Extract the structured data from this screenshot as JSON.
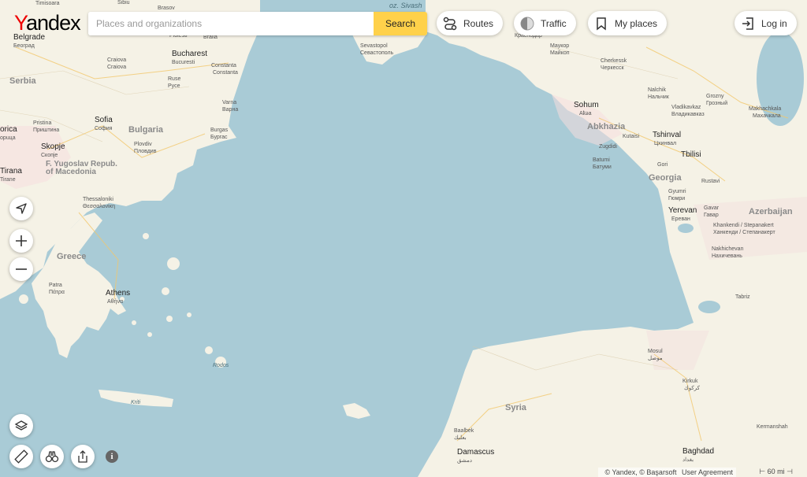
{
  "header": {
    "logo": "Yandex",
    "search_placeholder": "Places and organizations",
    "search_label": "Search",
    "routes_label": "Routes",
    "traffic_label": "Traffic",
    "myplaces_label": "My places",
    "login_label": "Log in"
  },
  "controls": {
    "info_icon": "info-icon"
  },
  "labels": {
    "belgrade": "Belgrade",
    "belgrade_sub": "Београд",
    "timisoara": "Timisoara",
    "sibiu": "Sibiu",
    "brasov": "Brasov",
    "sevastopol": "Sevastopol",
    "sevastopol_sub": "Севастополь",
    "krasnodar_sub": "Краснодар",
    "maukop": "Маукор",
    "maukop_sub": "Майкоп",
    "cherkessk": "Cherkessk",
    "cherkessk_sub": "Черкесск",
    "nalchik": "Nalchik",
    "nalchik_sub": "Нальчик",
    "grozny": "Grozny",
    "grozny_sub": "Грозный",
    "vladikavkaz": "Vladikavkaz",
    "vladikavkaz_sub": "Владикавказ",
    "makhachkala": "Makhachkala",
    "makhachkala_sub": "Махачкала",
    "serbia": "Serbia",
    "craiova": "Craiova",
    "craiova_sub": "Craiova",
    "bucharest": "Bucharest",
    "bucurest": "Bucuresti",
    "ploiesti": "Ploiesti",
    "braila": "Braila",
    "constanta": "Constanta",
    "constanta_sub": "Constanta",
    "ruse": "Ruse",
    "ruse_sub": "Русе",
    "varna": "Varna",
    "varna_sub": "Варна",
    "burgas": "Burgas",
    "burgas_sub": "Бургас",
    "pristina": "Pristina",
    "pristina_sub": "Приштина",
    "sofia": "Sofia",
    "sofia_sub": "София",
    "bulgaria": "Bulgaria",
    "plovdiv": "Plovdiv",
    "plovdiv_sub": "Пловдив",
    "skopje": "Skopje",
    "skopje_sub": "Скопје",
    "orica": "orica",
    "orica_sub": "opuцa",
    "macedonia": "F. Yugoslav Repub. of Macedonia",
    "tirana": "Tirana",
    "tirana_sub": "Tirane",
    "thessaloniki": "Thessaloniki",
    "thessaloniki_sub": "Θεσσαλονίκη",
    "greece": "Greece",
    "patra": "Patra",
    "patra_sub": "Πάτρα",
    "athens": "Athens",
    "athens_sub": "Αθήνα",
    "rodos": "Rodos",
    "kriti": "Kriti",
    "sohum": "Sohum",
    "sohum_sub": "Аҟəа",
    "abkhazia": "Abkhazia",
    "kutaisi": "Kutaisi",
    "zugdidi": "Zugdidi",
    "tshinval": "Tshinval",
    "tshinval_sub": "Цхинвал",
    "batumi": "Batumi",
    "batumi_sub": "Батуми",
    "tbilisi": "Tbilisi",
    "gori": "Gori",
    "georgia": "Georgia",
    "rustavi": "Rustavi",
    "gyumri": "Gyumri",
    "gyumri_sub": "Гюмри",
    "gavar": "Gavar",
    "gavar_sub": "Гавар",
    "yerevan": "Yerevan",
    "yerevan_sub": "Ереван",
    "khankendi": "Khankendi / Stepanakert",
    "khankendi_sub": "Ханкенди / Степанакерт",
    "azerbaijan": "Azerbaijan",
    "nakhichevan": "Nakhichevan",
    "nakhichevan_sub": "Нахичевань",
    "tabriz": "Tabriz",
    "mosul": "Mosul",
    "mosul_sub": "موصل",
    "kirkuk": "Kirkuk",
    "kirkuk_sub": "كركوك",
    "syria": "Syria",
    "baalbek": "Baalbek",
    "baalbek_sub": "بعلبك",
    "damascus": "Damascus",
    "damascus_sub": "دمشق",
    "baghdad": "Baghdad",
    "baghdad_sub": "بغداد",
    "kermanshah": "Kermanshah",
    "sivash": "oz. Sivash"
  },
  "footer": {
    "copyright": "© Yandex, © Başarsoft",
    "agreement": "User Agreement",
    "scale": "60 mi"
  },
  "colors": {
    "sea": "#a9cbd6",
    "land": "#f5f2e6",
    "search_button": "#ffd14a",
    "logo_red": "#e00000"
  }
}
